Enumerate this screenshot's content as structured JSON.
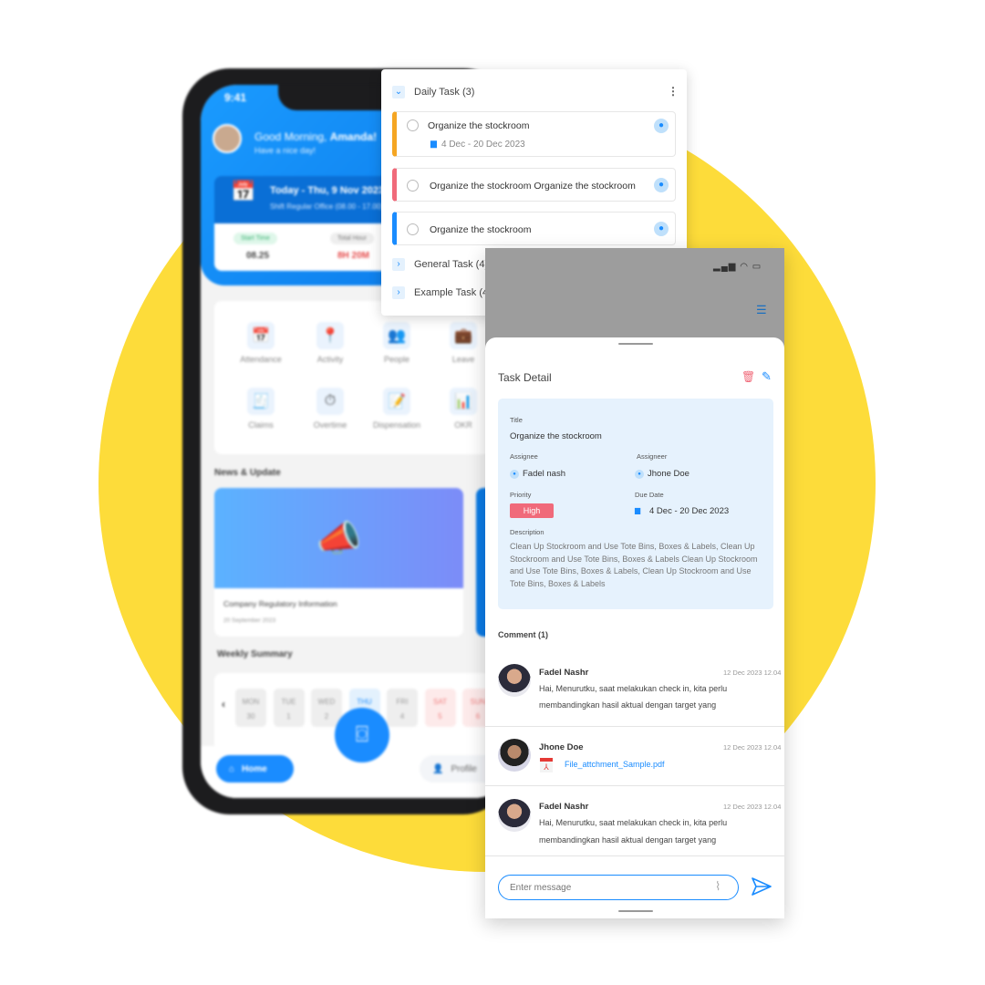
{
  "colors": {
    "background_circle": "#fddc3a",
    "primary": "#1a8cff",
    "danger": "#f06a7a",
    "warning": "#f5a623"
  },
  "home_app": {
    "status_time": "9:41",
    "greeting": "Good Morning, ",
    "user_name": "Amanda!",
    "subgreeting": "Have a nice day!",
    "today": "Today - Thu, 9 Nov 2023",
    "shift": "Shift Regular Office (08.00 - 17.00)",
    "start_time_label": "Start Time",
    "start_time": "08.25",
    "total_hour_label": "Total Hour",
    "total_hour": "8H 20M",
    "menu": [
      {
        "label": "Attendance",
        "icon": "calendar-icon"
      },
      {
        "label": "Activity",
        "icon": "location-pin-icon"
      },
      {
        "label": "People",
        "icon": "people-icon"
      },
      {
        "label": "Leave",
        "icon": "suitcase-icon"
      },
      {
        "label": "Claims",
        "icon": "receipt-icon"
      },
      {
        "label": "Overtime",
        "icon": "stopwatch-icon"
      },
      {
        "label": "Dispensation",
        "icon": "document-edit-icon"
      },
      {
        "label": "OKR",
        "icon": "chart-icon"
      }
    ],
    "news_title": "News & Update",
    "news": {
      "title": "Company Regulatory Information",
      "date": "20 September 2023"
    },
    "weekly_title": "Weekly Summary",
    "days": [
      {
        "d": "MON",
        "n": "30"
      },
      {
        "d": "TUE",
        "n": "1"
      },
      {
        "d": "WED",
        "n": "2"
      },
      {
        "d": "THU",
        "n": "3"
      },
      {
        "d": "FRI",
        "n": "4"
      },
      {
        "d": "SAT",
        "n": "5"
      },
      {
        "d": "SUN",
        "n": "6"
      }
    ],
    "nav": {
      "home": "Home",
      "profile": "Profile"
    }
  },
  "task_list": {
    "groups": [
      {
        "label": "Daily Task (3)",
        "expanded": true
      },
      {
        "label": "General Task (4)",
        "expanded": false
      },
      {
        "label": "Example Task (4)",
        "expanded": false
      }
    ],
    "tasks": [
      {
        "title": "Organize the stockroom",
        "date": "4 Dec - 20 Dec 2023",
        "color": "#f5a623"
      },
      {
        "title": "Organize the stockroom Organize the stockroom",
        "color": "#f06a7a"
      },
      {
        "title": "Organize the stockroom",
        "color": "#1a8cff"
      }
    ]
  },
  "task_detail": {
    "heading": "Task Detail",
    "title_label": "Title",
    "title": "Organize the stockroom",
    "assignee_label": "Assignee",
    "assignee": "Fadel nash",
    "assigneer_label": "Assigneer",
    "assigneer": "Jhone Doe",
    "priority_label": "Priority",
    "priority": "High",
    "due_label": "Due Date",
    "due": "4 Dec - 20 Dec 2023",
    "description_label": "Description",
    "description": "Clean Up Stockroom and Use Tote Bins, Boxes & Labels, Clean Up Stockroom and Use Tote Bins, Boxes & Labels Clean Up Stockroom and Use Tote Bins, Boxes & Labels, Clean Up Stockroom and Use Tote Bins, Boxes & Labels",
    "comments_label": "Comment (1)",
    "comments": [
      {
        "name": "Fadel Nashr",
        "date": "12 Dec 2023 12.04",
        "line1": "Hai, Menurutku, saat melakukan check in, kita perlu",
        "line2": "membandingkan hasil aktual dengan target yang"
      },
      {
        "name": "Jhone Doe",
        "date": "12 Dec 2023 12.04",
        "file": "File_attchment_Sample.pdf"
      },
      {
        "name": "Fadel Nashr",
        "date": "12 Dec 2023 12.04",
        "line1": "Hai, Menurutku, saat melakukan check in, kita perlu",
        "line2": "membandingkan hasil aktual dengan target yang"
      }
    ],
    "input_placeholder": "Enter message"
  }
}
